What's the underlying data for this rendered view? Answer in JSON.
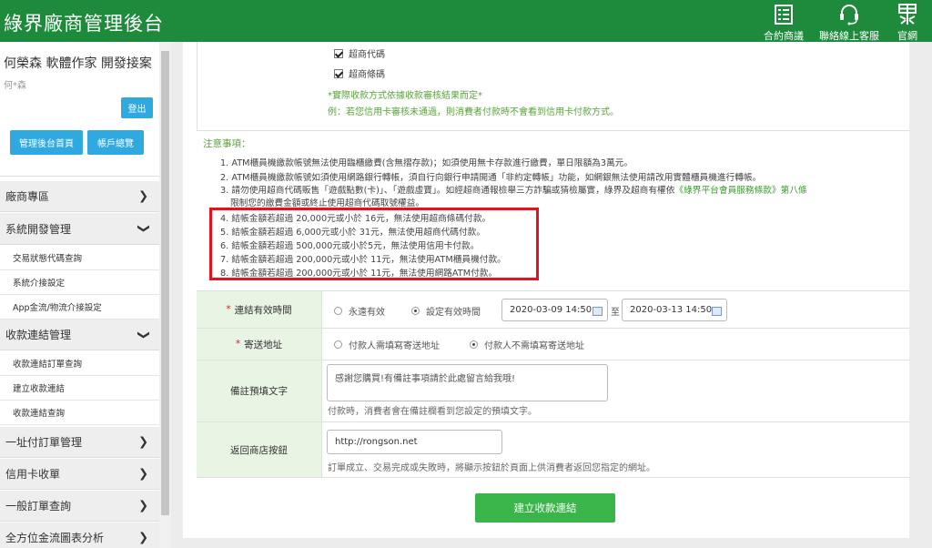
{
  "header": {
    "brand": "綠界廠商管理後台",
    "nav": [
      {
        "label": "合約商議",
        "icon": "contract-icon"
      },
      {
        "label": "聯絡線上客服",
        "icon": "headset-icon"
      },
      {
        "label": "官網",
        "icon": "ecpay-logo-icon"
      }
    ]
  },
  "sidebar": {
    "user_name": "何榮森 軟體作家 開發接案",
    "user_id": "何*森",
    "logout": "登出",
    "home_button": "管理後台首頁",
    "account_button": "帳戶總覽",
    "menus": [
      {
        "label": "廠商專區",
        "expanded": false
      },
      {
        "label": "系統開發管理",
        "expanded": true
      },
      {
        "label": "交易狀態代碼查詢"
      },
      {
        "label": "系統介接設定"
      },
      {
        "label": "App金流/物流介接設定"
      },
      {
        "label": "收款連結管理",
        "expanded": true
      },
      {
        "label": "收款連結訂單查詢"
      },
      {
        "label": "建立收款連結"
      },
      {
        "label": "收款連結查詢"
      },
      {
        "label": "一址付訂單管理",
        "expanded": false
      },
      {
        "label": "信用卡收單",
        "expanded": false
      },
      {
        "label": "一般訂單查詢",
        "expanded": false
      },
      {
        "label": "全方位金流圖表分析",
        "expanded": false
      }
    ]
  },
  "payment_methods": {
    "options": [
      {
        "label": "超商代碼",
        "checked": true
      },
      {
        "label": "超商條碼",
        "checked": true
      }
    ],
    "note1": "*實際收款方式依據收款審核結果而定*",
    "note2": "例：若您信用卡審核未通過，則消費者付款時不會看到信用卡付款方式。"
  },
  "notice": {
    "title": "注意事項：",
    "lines": [
      "1. ATM櫃員機繳款帳號無法使用臨櫃繳費(含無摺存款)；如須使用無卡存款進行繳費，單日限額為3萬元。",
      "2. ATM櫃員機繳款帳號如須使用網路銀行轉帳，須自行向銀行申請開通「非約定轉帳」功能，如網銀無法使用請改用實體櫃員機進行轉帳。",
      "3. 請勿使用超商代碼販售「遊戲點數(卡)」、「遊戲虛寶」。如經超商通報檢舉三方詐騙或猜檢屬實，綠界及超商有權依",
      "《綠界平台會員服務條款》第八條",
      "限制您的繳費金額或終止使用超商代碼取號權益。",
      "4. 結帳金額若超過 20,000元或小於 16元，無法使用超商條碼付款。",
      "5. 結帳金額若超過 6,000元或小於 31元，無法使用超商代碼付款。",
      "6. 結帳金額若超過 500,000元或小於5元，無法使用信用卡付款。",
      "7. 結帳金額若超過 200,000元或小於 11元，無法使用ATM櫃員機付款。",
      "8. 結帳金額若超過 200,000元或小於 11元，無法使用網路ATM付款。"
    ]
  },
  "form": {
    "validity": {
      "label": "連結有效時間",
      "options": [
        {
          "label": "永遠有效",
          "selected": false
        },
        {
          "label": "設定有效時間",
          "selected": true
        }
      ],
      "start": "2020-03-09 14:50",
      "to": "至",
      "end": "2020-03-13 14:50"
    },
    "shipping": {
      "label": "寄送地址",
      "options": [
        {
          "label": "付款人需填寫寄送地址",
          "selected": false
        },
        {
          "label": "付款人不需填寫寄送地址",
          "selected": true
        }
      ]
    },
    "remark": {
      "label": "備註預填文字",
      "value": "感謝您購買!有備註事項請於此處留言給我哦!",
      "hint": "付款時，消費者會在備註欄看到您設定的預填文字。"
    },
    "return_url": {
      "label": "返回商店按鈕",
      "value": "http://rongson.net",
      "hint": "訂單成立、交易完成或失敗時，將顯示按鈕於頁面上供消費者返回您指定的網址。"
    },
    "submit": "建立收款連結"
  },
  "colors": {
    "header": "#1e8a3c",
    "accent_blue": "#2fa9e0",
    "submit": "#3ab54a",
    "highlight": "#e8101d",
    "label_bg": "#e8f4e4"
  }
}
